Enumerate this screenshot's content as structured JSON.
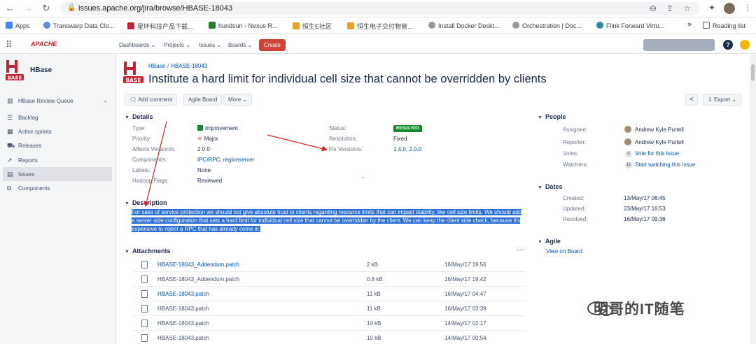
{
  "browser": {
    "url": "issues.apache.org/jira/browse/HBASE-18043",
    "bookmarks": [
      "Apps",
      "Transwarp Data Clo...",
      "星环科技产品下载...",
      "hundsun - Nexus R...",
      "恒生E社区",
      "恒生电子交付物管...",
      "Install Docker Deskt...",
      "Orchestration | Doc...",
      "Flink Forward Virtu...",
      "»",
      "Reading list"
    ]
  },
  "jira_nav": {
    "menus": [
      "Dashboards ⌄",
      "Projects ⌄",
      "Issues ⌄",
      "Boards ⌄"
    ],
    "create_label": "Create",
    "help_label": "?"
  },
  "sidebar": {
    "project_name": "HBase",
    "queue_label": "HBase Review Queue",
    "items": [
      "Backlog",
      "Active sprints",
      "Releases",
      "Reports",
      "Issues",
      "Components"
    ]
  },
  "issue": {
    "breadcrumb_project": "HBase",
    "breadcrumb_key": "HBASE-18043",
    "title": "Institute a hard limit for individual cell size that cannot be overridden by clients",
    "actions": [
      "Add comment",
      "Agile Board",
      "More ⌄"
    ],
    "export_label": "Export ⌄"
  },
  "details": {
    "heading": "Details",
    "type_key": "Type:",
    "type": "Improvement",
    "priority_key": "Priority:",
    "priority": "Major",
    "affects_key": "Affects Version/s:",
    "affects": "2.0.0",
    "components_key": "Component/s:",
    "components": "IPC/RPC, regionserver",
    "labels_key": "Labels:",
    "labels": "None",
    "flags_key": "Hadoop Flags:",
    "flags": "Reviewed",
    "status_key": "Status:",
    "status": "RESOLVED",
    "resolution_key": "Resolution:",
    "resolution": "Fixed",
    "fix_key": "Fix Version/s:",
    "fix": "1.4.0, 2.0.0"
  },
  "description": {
    "heading": "Description",
    "text": "For sake of service protection we should not give absolute trust to clients regarding resource limits that can impact stability, like cell size limits. We should add a server side configuration that sets a hard limit for individual cell size that cannot be overridden by the client. We can keep the client side check, because it's expensive to reject a RPC that has already come in."
  },
  "attachments": {
    "heading": "Attachments",
    "more": "···",
    "rows": [
      {
        "name": "HBASE-18043_Addendum.patch",
        "size": "2 kB",
        "date": "16/May/17 19:56"
      },
      {
        "name": "HBASE-18043_Addendum.patch",
        "size": "0.8 kB",
        "date": "16/May/17 19:42"
      },
      {
        "name": "HBASE-18043.patch",
        "size": "11 kB",
        "date": "16/May/17 04:47"
      },
      {
        "name": "HBASE-18043.patch",
        "size": "11 kB",
        "date": "16/May/17 03:39"
      },
      {
        "name": "HBASE-18043.patch",
        "size": "10 kB",
        "date": "14/May/17 02:17"
      },
      {
        "name": "HBASE-18043.patch",
        "size": "10 kB",
        "date": "14/May/17 00:54"
      }
    ]
  },
  "people": {
    "heading": "People",
    "assignee_key": "Assignee:",
    "assignee": "Andrew Kyle Purtell",
    "reporter_key": "Reporter:",
    "reporter": "Andrew Kyle Purtell",
    "votes_key": "Votes:",
    "votes_count": "0",
    "votes_link": "Vote for this issue",
    "watchers_key": "Watchers:",
    "watchers_count": "12",
    "watchers_link": "Start watching this issue"
  },
  "dates": {
    "heading": "Dates",
    "created_key": "Created:",
    "created": "13/May/17 06:45",
    "updated_key": "Updated:",
    "updated": "23/May/17 16:53",
    "resolved_key": "Resolved:",
    "resolved": "16/May/17 09:36"
  },
  "agile": {
    "heading": "Agile",
    "link": "View on Board"
  },
  "watermark": "明哥的IT随笔",
  "colors": {
    "accent": "#0052cc",
    "create": "#d04437",
    "resolved": "#14892c",
    "highlight": "#2a6fd6",
    "annotation": "#e02020"
  }
}
